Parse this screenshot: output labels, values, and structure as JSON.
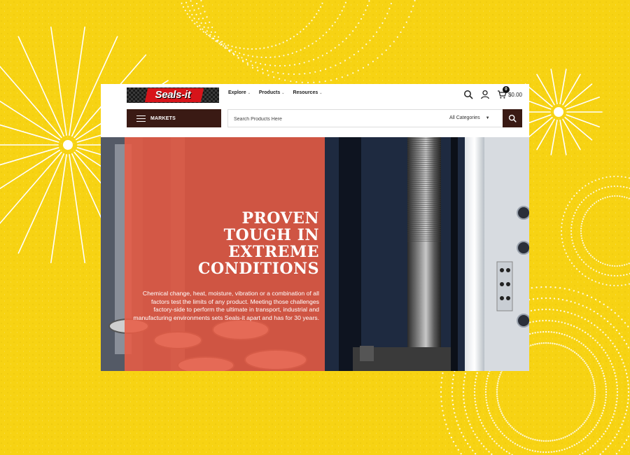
{
  "header": {
    "logo_text": "Seals-it",
    "nav": [
      {
        "label": "Explore"
      },
      {
        "label": "Products"
      },
      {
        "label": "Resources"
      }
    ],
    "cart": {
      "count": "0",
      "total": "$0.00"
    }
  },
  "toolbar": {
    "markets_label": "MARKETS",
    "search_placeholder": "Search Products Here",
    "category_selected": "All Categories"
  },
  "hero": {
    "title_lines": [
      "Proven",
      "tough in",
      "extreme",
      "conditions"
    ],
    "body": "Chemical change, heat, moisture, vibration or a combination of all factors test the limits of any product. Meeting those challenges factory-side to perform the ultimate in transport, industrial and manufacturing environments sets Seals-it apart and has for 30 years."
  },
  "icons": [
    "search-icon",
    "user-icon",
    "cart-icon",
    "chevron-down-icon",
    "hamburger-icon"
  ],
  "colors": {
    "background_yellow": "#f7d313",
    "dark_brown": "#3a1a14",
    "hero_overlay": "#e85c46",
    "logo_red": "#d7141a"
  }
}
